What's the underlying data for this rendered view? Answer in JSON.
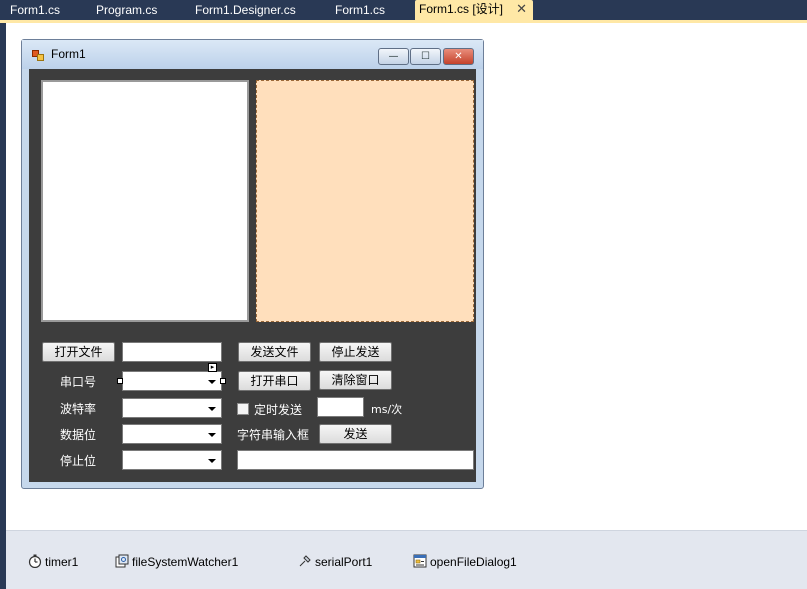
{
  "tabs": [
    {
      "label": "Form1.cs",
      "active": false
    },
    {
      "label": "Program.cs",
      "active": false
    },
    {
      "label": "Form1.Designer.cs",
      "active": false
    },
    {
      "label": "Form1.cs",
      "active": false
    },
    {
      "label": "Form1.cs [设计]",
      "active": true
    }
  ],
  "tab_close_glyph": "✕",
  "form": {
    "title": "Form1",
    "minimize_glyph": "—",
    "maximize_glyph": "☐",
    "close_glyph": "✕",
    "buttons": {
      "open_file": "打开文件",
      "send_file": "发送文件",
      "stop_send": "停止发送",
      "open_port": "打开串口",
      "clear_window": "清除窗口",
      "send": "发送"
    },
    "labels": {
      "port": "串口号",
      "baud": "波特率",
      "data_bits": "数据位",
      "stop_bits": "停止位",
      "timed_send": "定时发送",
      "interval_unit": "ms/次",
      "string_input": "字符串输入框"
    },
    "smart_tag_glyph": "▸"
  },
  "tray": {
    "items": [
      {
        "label": "timer1",
        "icon": "timer-icon"
      },
      {
        "label": "fileSystemWatcher1",
        "icon": "filesystemwatcher-icon"
      },
      {
        "label": "serialPort1",
        "icon": "serialport-icon"
      },
      {
        "label": "openFileDialog1",
        "icon": "openfiledialog-icon"
      }
    ]
  },
  "colors": {
    "ide_background": "#293955",
    "active_tab": "#ffe8a6",
    "form_client": "#3d3d3d",
    "peach_panel": "#ffdfbc",
    "tray_background": "#e3e7ef"
  }
}
